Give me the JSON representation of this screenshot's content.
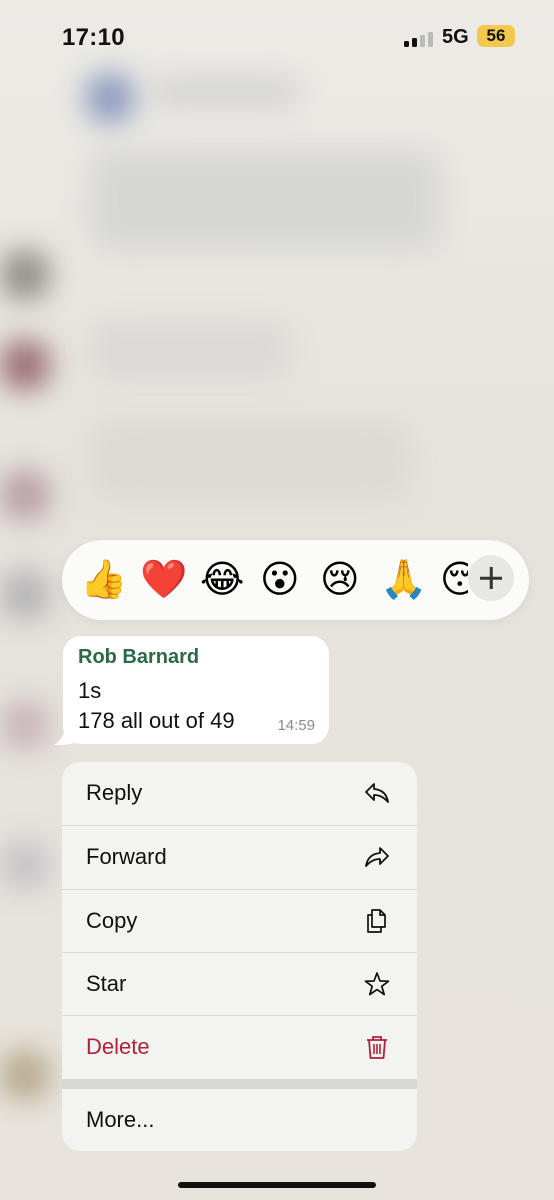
{
  "status_bar": {
    "time": "17:10",
    "network": "5G",
    "battery": "56",
    "battery_color": "#f2c94c"
  },
  "reactions": {
    "emojis": [
      "👍",
      "❤️",
      "😂",
      "😮",
      "😢",
      "🙏",
      "😴"
    ],
    "more_icon": "plus-icon"
  },
  "message": {
    "sender": "Rob Barnard",
    "lines": [
      "1s",
      "178 all out of 49"
    ],
    "time": "14:59",
    "sender_color": "#2a6a46"
  },
  "menu": {
    "items": [
      {
        "label": "Reply",
        "icon": "reply-icon"
      },
      {
        "label": "Forward",
        "icon": "forward-icon"
      },
      {
        "label": "Copy",
        "icon": "copy-icon"
      },
      {
        "label": "Star",
        "icon": "star-icon"
      },
      {
        "label": "Delete",
        "icon": "trash-icon"
      },
      {
        "label": "More..."
      }
    ],
    "delete_color": "#b3213b"
  }
}
